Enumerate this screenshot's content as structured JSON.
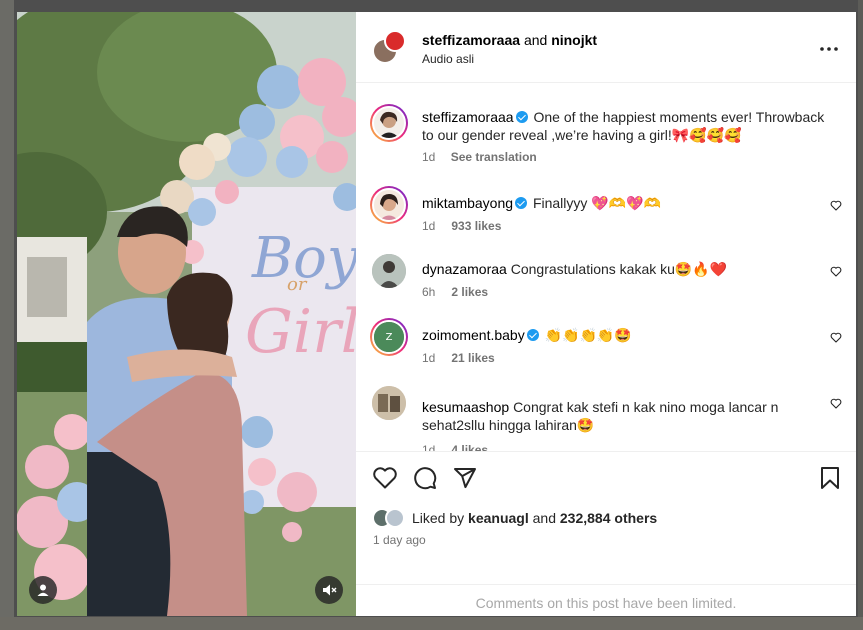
{
  "post": {
    "header": {
      "author_primary": "steffizamoraaa",
      "and_text": "and",
      "author_secondary": "ninojkt",
      "audio": "Audio asli",
      "more_icon": "more-horizontal-icon"
    },
    "caption": {
      "username": "steffizamoraaa",
      "verified": true,
      "text": "One of the happiest moments ever! Throwback to our gender reveal ,we’re having a girl!🎀🥰🥰🥰",
      "time": "1d",
      "translate": "See translation"
    },
    "comments": [
      {
        "username": "miktambayong",
        "verified": true,
        "text": "Finallyyy 💖🫶💖🫶",
        "time": "1d",
        "likes": "933 likes"
      },
      {
        "username": "dynazamoraa",
        "verified": false,
        "text": "Congrastulations kakak ku🤩🔥❤️",
        "time": "6h",
        "likes": "2 likes"
      },
      {
        "username": "zoimoment.baby",
        "verified": true,
        "text": "👏👏👏👏🤩",
        "time": "1d",
        "likes": "21 likes"
      },
      {
        "username": "kesumaashop",
        "verified": false,
        "text": "Congrat kak stefi n kak nino moga lancar n sehat2sllu hingga lahiran🤩",
        "time": "1d",
        "likes": "4 likes"
      }
    ],
    "actions": {
      "like_icon": "heart-icon",
      "comment_icon": "comment-icon",
      "share_icon": "send-icon",
      "save_icon": "bookmark-icon"
    },
    "liked_by": {
      "prefix": "Liked by",
      "user": "keanuagl",
      "middle": "and",
      "others": "232,884 others"
    },
    "date": "1 day ago",
    "comments_limited": "Comments on this post have been limited.",
    "media": {
      "backdrop_text_1": "Boy",
      "backdrop_text_2": "or",
      "backdrop_text_3": "Girl",
      "user_tag_icon": "user-tag-icon",
      "mute_icon": "volume-muted-icon"
    }
  },
  "colors": {
    "verified_blue": "#1d9bf0",
    "muted_text": "#737373",
    "border": "#efefef"
  }
}
